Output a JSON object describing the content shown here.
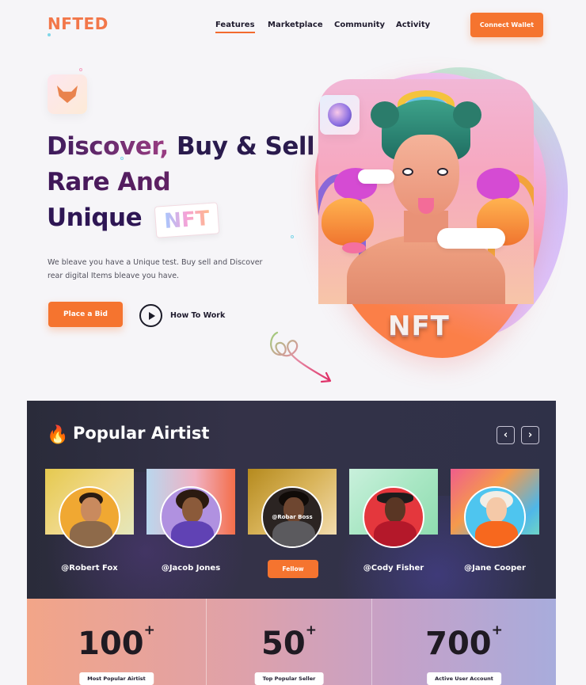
{
  "brand": {
    "logo": "NFTED"
  },
  "nav": {
    "items": [
      {
        "label": "Features",
        "active": true
      },
      {
        "label": "Marketplace",
        "active": false
      },
      {
        "label": "Community",
        "active": false
      },
      {
        "label": "Activity",
        "active": false
      }
    ],
    "connect_label": "Connect Wallet"
  },
  "hero": {
    "headline": {
      "line1_a": "Discover,",
      "line1_b": "Buy & Sell",
      "line2": "Rare And",
      "line3": "Unique"
    },
    "nft_tag": "NFT",
    "description": "We bleave you have a Unique test. Buy sell and Discover rear digital Items bleave you have.",
    "primary_button": "Place a Bid",
    "secondary_button": "How To Work",
    "art_label": "NFT"
  },
  "popular": {
    "title": "Popular Airtist",
    "prev_icon": "‹",
    "next_icon": "›",
    "artists": [
      {
        "name": "@Robert Fox"
      },
      {
        "name": "@Jacob Jones"
      },
      {
        "name": "@Robar Boss",
        "follow_label": "Fellow"
      },
      {
        "name": "@Cody Fisher"
      },
      {
        "name": "@Jane Cooper"
      }
    ]
  },
  "stats": [
    {
      "value": "100",
      "suffix": "+",
      "label": "Most Popular Airtist"
    },
    {
      "value": "50",
      "suffix": "+",
      "label": "Top Popular Seller"
    },
    {
      "value": "700",
      "suffix": "+",
      "label": "Active User Account"
    }
  ],
  "colors": {
    "accent": "#f5742f",
    "heading": "#2a1b4d",
    "dark_panel": "#2f3042"
  }
}
